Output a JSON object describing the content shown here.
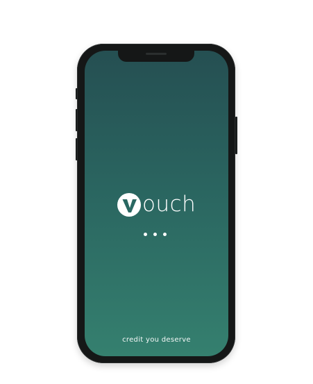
{
  "app": {
    "brand_name": "ouch",
    "brand_full": "Vouch",
    "tagline": "credit you deserve",
    "loading_dots": 3
  },
  "colors": {
    "screen_top": "#254f52",
    "screen_bottom": "#35806f",
    "logo": "#ffffff",
    "frame": "#151717"
  },
  "icons": {
    "logo_mark": "v-circle-logo",
    "loading": "loading-dots"
  }
}
